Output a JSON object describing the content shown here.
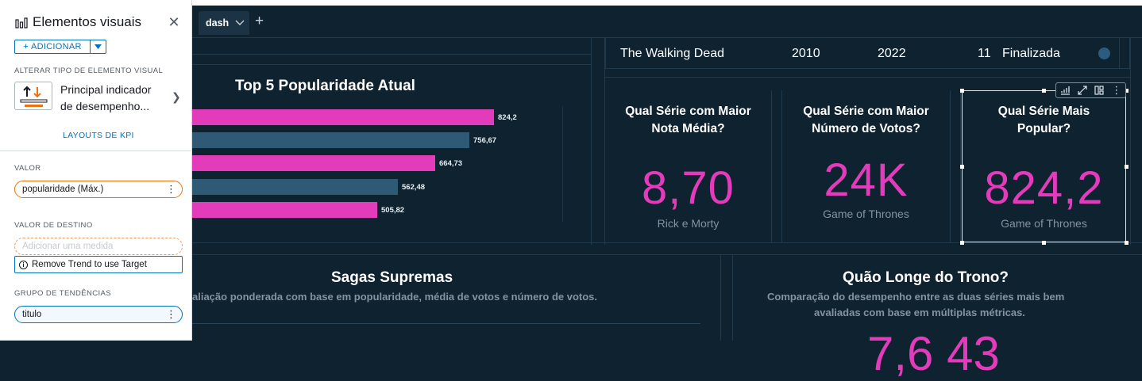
{
  "panel": {
    "title": "Elementos visuais",
    "add_label": "ADICIONAR",
    "change_type_label": "ALTERAR TIPO DE ELEMENTO VISUAL",
    "visual_type": "Principal indicador de desempenho...",
    "layouts_link": "LAYOUTS DE KPI",
    "value_label": "VALOR",
    "value_field": "popularidade (Máx.)",
    "target_label": "VALOR DE DESTINO",
    "target_placeholder": "Adicionar uma medida",
    "target_info": "Remove Trend to use Target",
    "trend_label": "GRUPO DE TENDÊNCIAS",
    "trend_field": "titulo"
  },
  "tabs": {
    "active": "dash"
  },
  "top5": {
    "title": "Top 5 Popularidade Atual"
  },
  "chart_data": {
    "type": "bar",
    "orientation": "horizontal",
    "title": "Top 5 Popularidade Atual",
    "values": [
      824.2,
      756.67,
      664.73,
      562.48,
      505.82
    ],
    "labels": [
      "824,2",
      "756,67",
      "664,73",
      "562,48",
      "505,82"
    ],
    "colors": [
      "#e23cbb",
      "#2f5a76",
      "#e23cbb",
      "#2f5a76",
      "#e23cbb"
    ],
    "xlim": [
      0,
      824.2
    ]
  },
  "table_row": {
    "title": "The Walking Dead",
    "start": "2010",
    "end": "2022",
    "seasons": "11",
    "status": "Finalizada"
  },
  "kpis": [
    {
      "question": "Qual Série com Maior Nota Média?",
      "value": "8,70",
      "subtitle": "Rick e Morty"
    },
    {
      "question": "Qual Série com Maior Número de Votos?",
      "value": "24K",
      "subtitle": "Game of Thrones"
    },
    {
      "question": "Qual Série Mais Popular?",
      "value": "824,2",
      "subtitle": "Game of Thrones"
    }
  ],
  "sagas": {
    "title": "Sagas Supremas",
    "subtitle": "aliação ponderada com base em popularidade, média de votos e número de votos."
  },
  "trono": {
    "title": "Quão Longe do Trono?",
    "subtitle_1": "Comparação do desempenho entre as duas séries mais bem",
    "subtitle_2": "avaliadas com base em múltiplas métricas.",
    "value_partial": "7,6 43"
  },
  "colors": {
    "accent_pink": "#e43bbc",
    "bar_blue": "#2f5a76",
    "bg": "#0f2230",
    "link_blue": "#0073bb",
    "orange": "#ec7211"
  }
}
